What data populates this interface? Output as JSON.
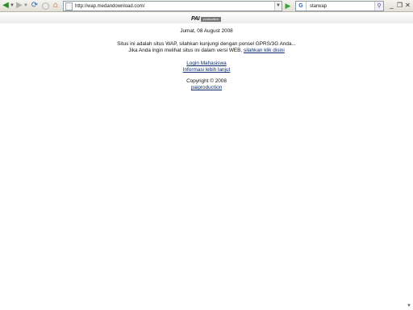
{
  "browser": {
    "url": "http://wap.medandownload.com/",
    "search_value": "starwap",
    "icons": {
      "back": "back-arrow-icon",
      "forward": "forward-arrow-icon",
      "reload": "reload-icon",
      "stop": "stop-icon",
      "home": "home-icon",
      "go": "go-arrow-icon",
      "search_engine": "google-icon",
      "search_go": "magnifier-icon"
    }
  },
  "page": {
    "logo_main": "PAI",
    "logo_sub": "production",
    "date": "Jumat, 08 August 2008",
    "message_line1": "Situs ini adalah situs WAP, silahkan kunjungi dengan ponsel GPRS/3G Anda...",
    "message_line2": "Jika Anda ingin melihat situs ini dalam versi WEB,",
    "web_link": "silahkan klik disini",
    "login_link": "Login Mahasiswa",
    "info_link": "Informasi lebih lanjut",
    "copyright": "Copyright © 2008",
    "author_link": "paiproduction"
  },
  "colors": {
    "link": "#0b2a6b",
    "toolbar": "#e9e7df"
  }
}
